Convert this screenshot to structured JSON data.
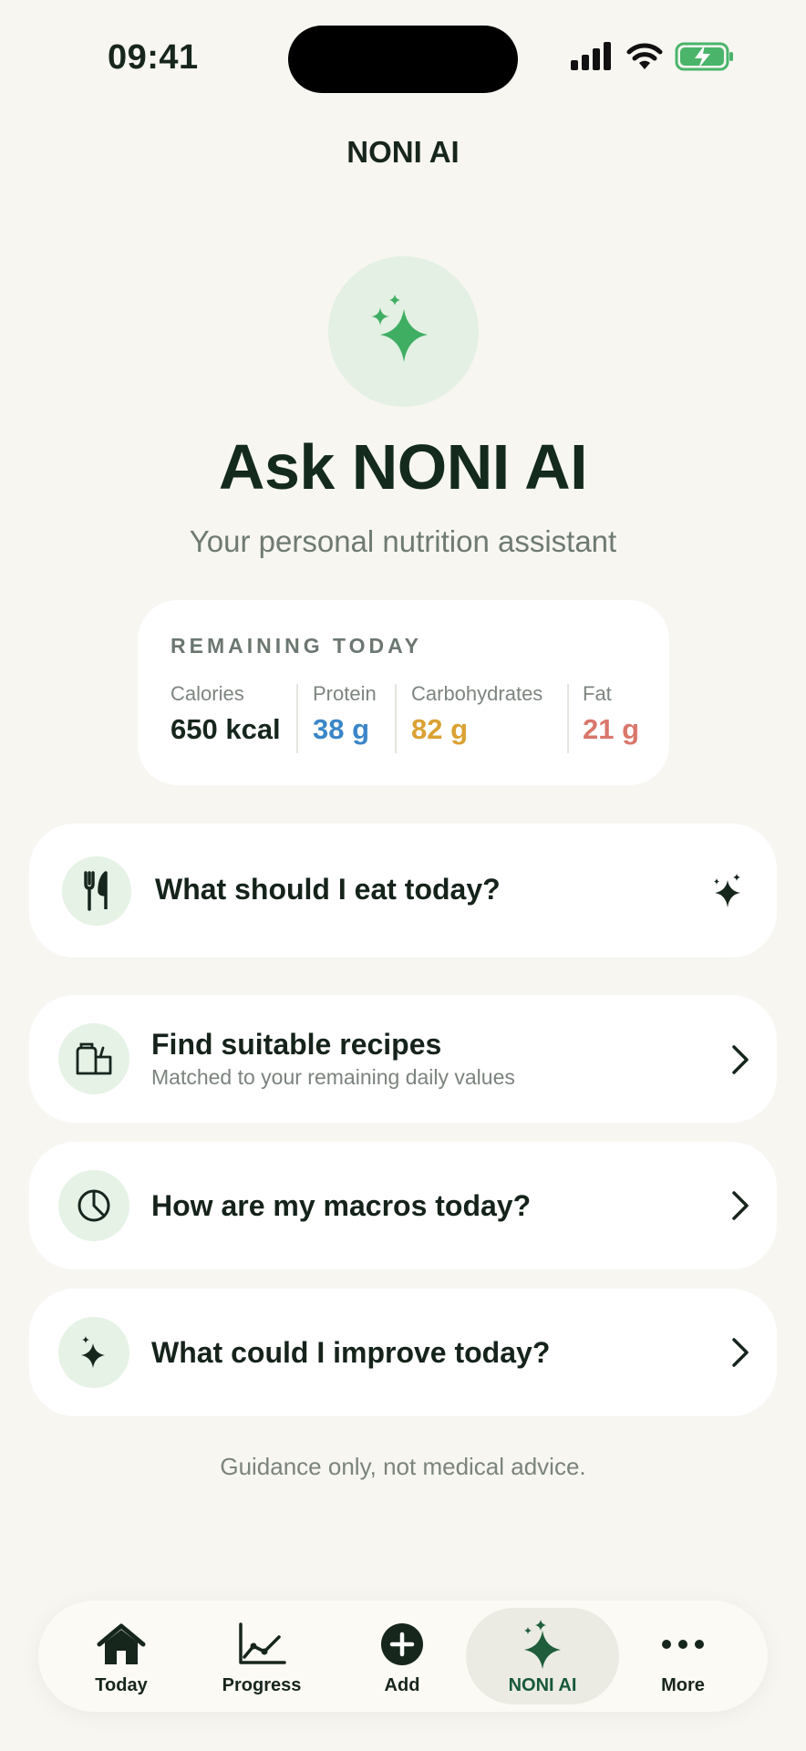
{
  "status_bar": {
    "time": "09:41"
  },
  "header": {
    "title": "NONI AI"
  },
  "hero": {
    "icon": "sparkle-icon",
    "title": "Ask NONI AI",
    "subtitle": "Your personal nutrition assistant"
  },
  "remaining": {
    "heading": "REMAINING TODAY",
    "macros": [
      {
        "label": "Calories",
        "value": "650 kcal",
        "color": "#17261d"
      },
      {
        "label": "Protein",
        "value": "38 g",
        "color": "#3a86c8"
      },
      {
        "label": "Carbohydrates",
        "value": "82 g",
        "color": "#dba133"
      },
      {
        "label": "Fat",
        "value": "21 g",
        "color": "#d9776b"
      }
    ]
  },
  "actions": [
    {
      "title": "What should I eat today?",
      "icon": "fork-knife-icon",
      "trailing": "sparkle-icon"
    },
    {
      "title": "Find suitable recipes",
      "subtitle": "Matched to your remaining daily values",
      "icon": "recipe-bag-icon",
      "trailing": "chevron-right-icon"
    },
    {
      "title": "How are my macros today?",
      "icon": "pie-chart-icon",
      "trailing": "chevron-right-icon"
    },
    {
      "title": "What could I improve today?",
      "icon": "sparkle-icon",
      "trailing": "chevron-right-icon"
    }
  ],
  "disclaimer": "Guidance only, not medical advice.",
  "tabs": [
    {
      "label": "Today",
      "icon": "home-icon"
    },
    {
      "label": "Progress",
      "icon": "chart-line-icon"
    },
    {
      "label": "Add",
      "icon": "plus-circle-icon"
    },
    {
      "label": "NONI AI",
      "icon": "sparkle-icon",
      "active": true
    },
    {
      "label": "More",
      "icon": "more-icon"
    }
  ],
  "colors": {
    "accent": "#3fae63",
    "background": "#f7f6f1",
    "active_tab_text": "#17593a"
  }
}
